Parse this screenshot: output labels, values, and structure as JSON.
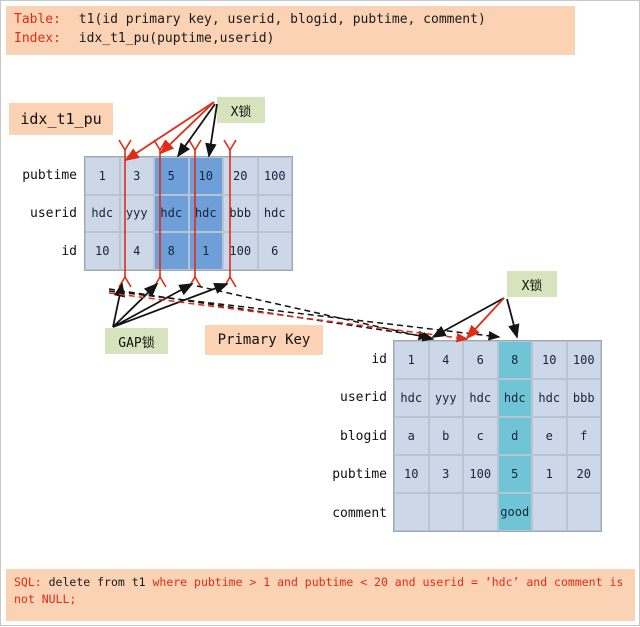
{
  "header": {
    "line1_label": "Table:",
    "line1_value": "t1(id primary key, userid, blogid, pubtime, comment)",
    "line2_label": "Index:",
    "line2_value": "idx_t1_pu(puptime,userid)"
  },
  "labels": {
    "index_name": "idx_t1_pu",
    "xlock_index": "X锁",
    "xlock_pk": "X锁",
    "gap_lock": "GAP锁",
    "primary_key": "Primary Key"
  },
  "index_table": {
    "row_labels": [
      "pubtime",
      "userid",
      "id"
    ],
    "rows": [
      [
        "1",
        "3",
        "5",
        "10",
        "20",
        "100"
      ],
      [
        "hdc",
        "yyy",
        "hdc",
        "hdc",
        "bbb",
        "hdc"
      ],
      [
        "10",
        "4",
        "8",
        "1",
        "100",
        "6"
      ]
    ],
    "highlighted_columns": [
      2,
      3
    ],
    "highlight_color": "#6f9fd8",
    "base_color": "#ccd8e8"
  },
  "pk_table": {
    "row_labels": [
      "id",
      "userid",
      "blogid",
      "pubtime",
      "comment"
    ],
    "rows": [
      [
        "1",
        "4",
        "6",
        "8",
        "10",
        "100"
      ],
      [
        "hdc",
        "yyy",
        "hdc",
        "hdc",
        "hdc",
        "bbb"
      ],
      [
        "a",
        "b",
        "c",
        "d",
        "e",
        "f"
      ],
      [
        "10",
        "3",
        "100",
        "5",
        "1",
        "20"
      ],
      [
        "",
        "",
        "",
        "good",
        "",
        ""
      ]
    ],
    "highlighted_columns": [
      3
    ],
    "highlight_color": "#6fc5d6",
    "base_color": "#ccd8e8"
  },
  "sql": {
    "prefix": "SQL:",
    "seg_delete": " delete from t1 ",
    "seg_where": "where pubtime > 1 and pubtime < 20 and userid =  ‘hdc’ and comment is not NULL;",
    "full": "SQL: delete from t1 where pubtime > 1 and pubtime < 20 and userid =  ‘hdc’ and comment is not NULL;"
  },
  "colors": {
    "banner_bg": "#fbd3b4",
    "chip_green": "#d7e3bc",
    "red": "#e02b16",
    "black": "#141414"
  }
}
